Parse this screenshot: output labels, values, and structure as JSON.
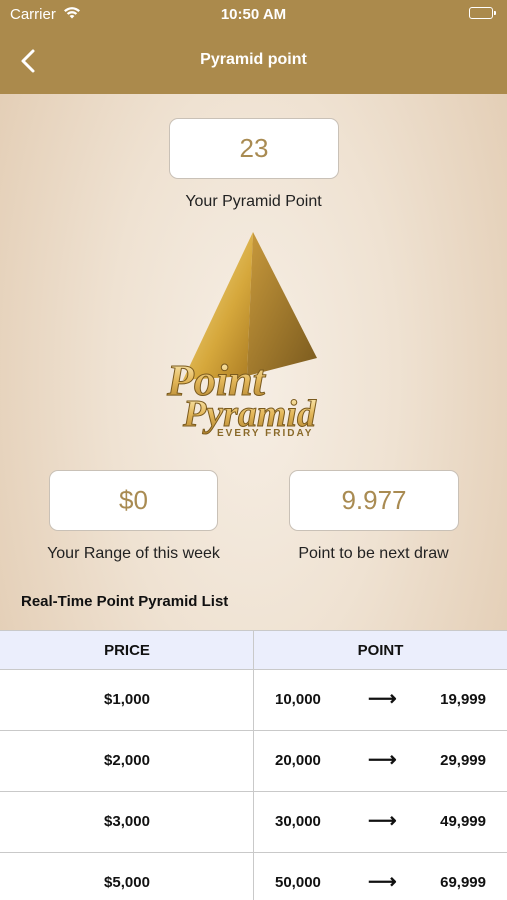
{
  "status_bar": {
    "carrier": "Carrier",
    "time": "10:50 AM"
  },
  "nav": {
    "title": "Pyramid point",
    "back_icon": "chevron-left-icon"
  },
  "pyramid_point": {
    "value": "23",
    "label": "Your Pyramid Point"
  },
  "logo": {
    "word1": "Point",
    "word2": "Pyramid",
    "tagline": "EVERY FRIDAY"
  },
  "range": {
    "value": "$0",
    "label": "Your Range of this week"
  },
  "next_draw": {
    "value": "9.977",
    "label": "Point to be next draw"
  },
  "list": {
    "title": "Real-Time Point Pyramid List",
    "headers": {
      "price": "PRICE",
      "point": "POINT"
    },
    "arrow": "⟶",
    "rows": [
      {
        "price": "$1,000",
        "from": "10,000",
        "to": "19,999"
      },
      {
        "price": "$2,000",
        "from": "20,000",
        "to": "29,999"
      },
      {
        "price": "$3,000",
        "from": "30,000",
        "to": "49,999"
      },
      {
        "price": "$5,000",
        "from": "50,000",
        "to": "69,999"
      }
    ]
  },
  "colors": {
    "header": "#ab8a4c",
    "value_text": "#a98b52",
    "table_header_bg": "#ebeefc"
  }
}
